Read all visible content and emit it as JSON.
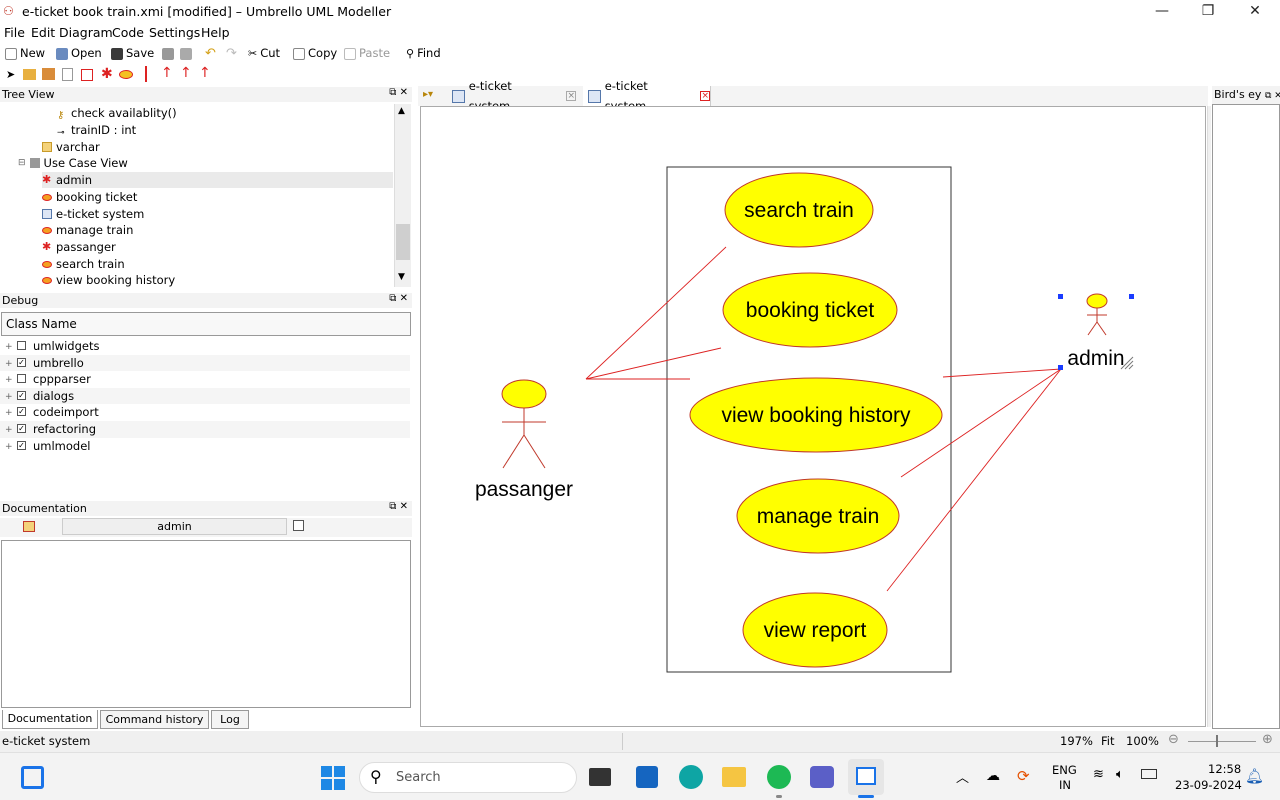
{
  "window": {
    "title": "e-ticket book train.xmi [modified] – Umbrello UML Modeller",
    "min": "—",
    "max": "❐",
    "close": "✕"
  },
  "menu": [
    "File",
    "Edit",
    "Diagram",
    "Code",
    "Settings",
    "Help"
  ],
  "toolbar": {
    "new": "New",
    "open": "Open",
    "save": "Save",
    "cut": "Cut",
    "copy": "Copy",
    "paste": "Paste",
    "find": "Find"
  },
  "tree_view": {
    "title": "Tree View",
    "items": [
      "check availablity()",
      "trainID : int",
      "varchar",
      "Use Case View",
      "admin",
      "booking ticket",
      "e-ticket system",
      "manage train",
      "passanger",
      "search train",
      "view booking history"
    ]
  },
  "debug": {
    "title": "Debug",
    "column": "Class Name",
    "rows": [
      {
        "name": "umlwidgets",
        "checked": false
      },
      {
        "name": "umbrello",
        "checked": true
      },
      {
        "name": "cppparser",
        "checked": false
      },
      {
        "name": "dialogs",
        "checked": true
      },
      {
        "name": "codeimport",
        "checked": true
      },
      {
        "name": "refactoring",
        "checked": true
      },
      {
        "name": "umlmodel",
        "checked": true
      }
    ]
  },
  "documentation": {
    "title": "Documentation",
    "name": "admin"
  },
  "bottom_tabs": [
    "Documentation",
    "Command history",
    "Log"
  ],
  "tabs": [
    "e-ticket system",
    "e-ticket system"
  ],
  "birds_eye": "Bird's ey",
  "diagram": {
    "actors": [
      "passanger",
      "admin"
    ],
    "use_cases": [
      "search train",
      "booking ticket",
      "view booking history",
      "manage train",
      "view report"
    ]
  },
  "status": {
    "text": "e-ticket system",
    "zoom": "197%",
    "fit": "Fit",
    "hundred": "100%"
  },
  "taskbar": {
    "search": "Search",
    "lang1": "ENG",
    "lang2": "IN",
    "time": "12:58",
    "date": "23-09-2024"
  }
}
